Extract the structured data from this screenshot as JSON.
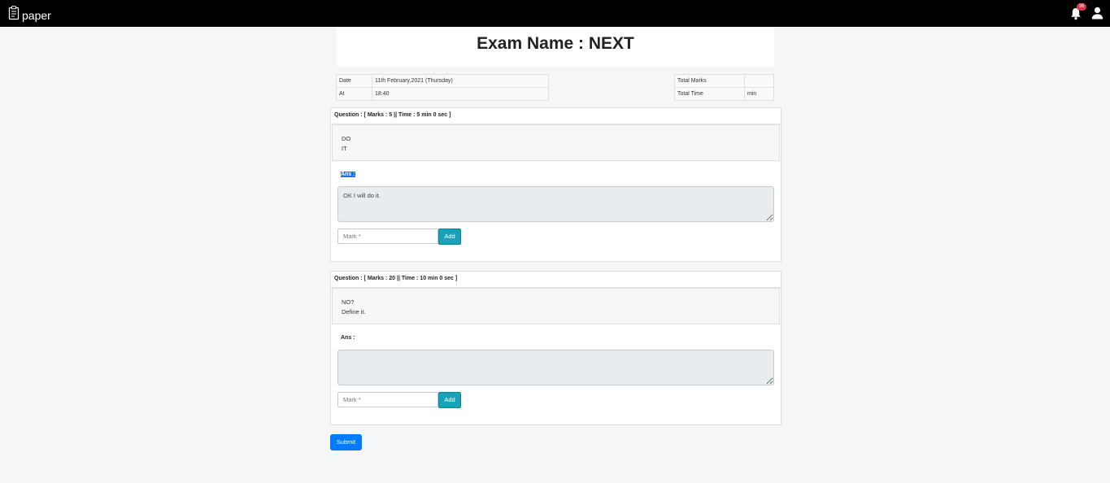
{
  "navbar": {
    "brand": "paper",
    "notification_count": "36"
  },
  "exam": {
    "title": "Exam Name : NEXT"
  },
  "info_left": {
    "date_label": "Date",
    "date_value": "11th February,2021 (Thursday)",
    "at_label": "At",
    "at_value": "18:40"
  },
  "info_right": {
    "total_marks_label": "Total Marks",
    "total_marks_value": "",
    "total_time_label": "Total Time",
    "total_time_value": "min"
  },
  "questions": [
    {
      "header": "Question : [ Marks : 5 || Time : 5 min 0 sec ]",
      "lines": [
        "DO",
        "IT"
      ],
      "ans_label": "Ans :",
      "answer": "OK I will do it.",
      "mark_placeholder": "Mark *",
      "add_label": "Add"
    },
    {
      "header": "Question : [ Marks : 20 || Time : 10 min 0 sec ]",
      "lines": [
        "NO?",
        "Define it."
      ],
      "ans_label": "Ans :",
      "answer": "",
      "mark_placeholder": "Mark *",
      "add_label": "Add"
    }
  ],
  "submit_label": "Submit",
  "colors": {
    "navbar": "#000000",
    "badge": "#dc3545",
    "add_button": "#17a2b8",
    "submit_button": "#007bff",
    "selection": "#1a73e8"
  }
}
